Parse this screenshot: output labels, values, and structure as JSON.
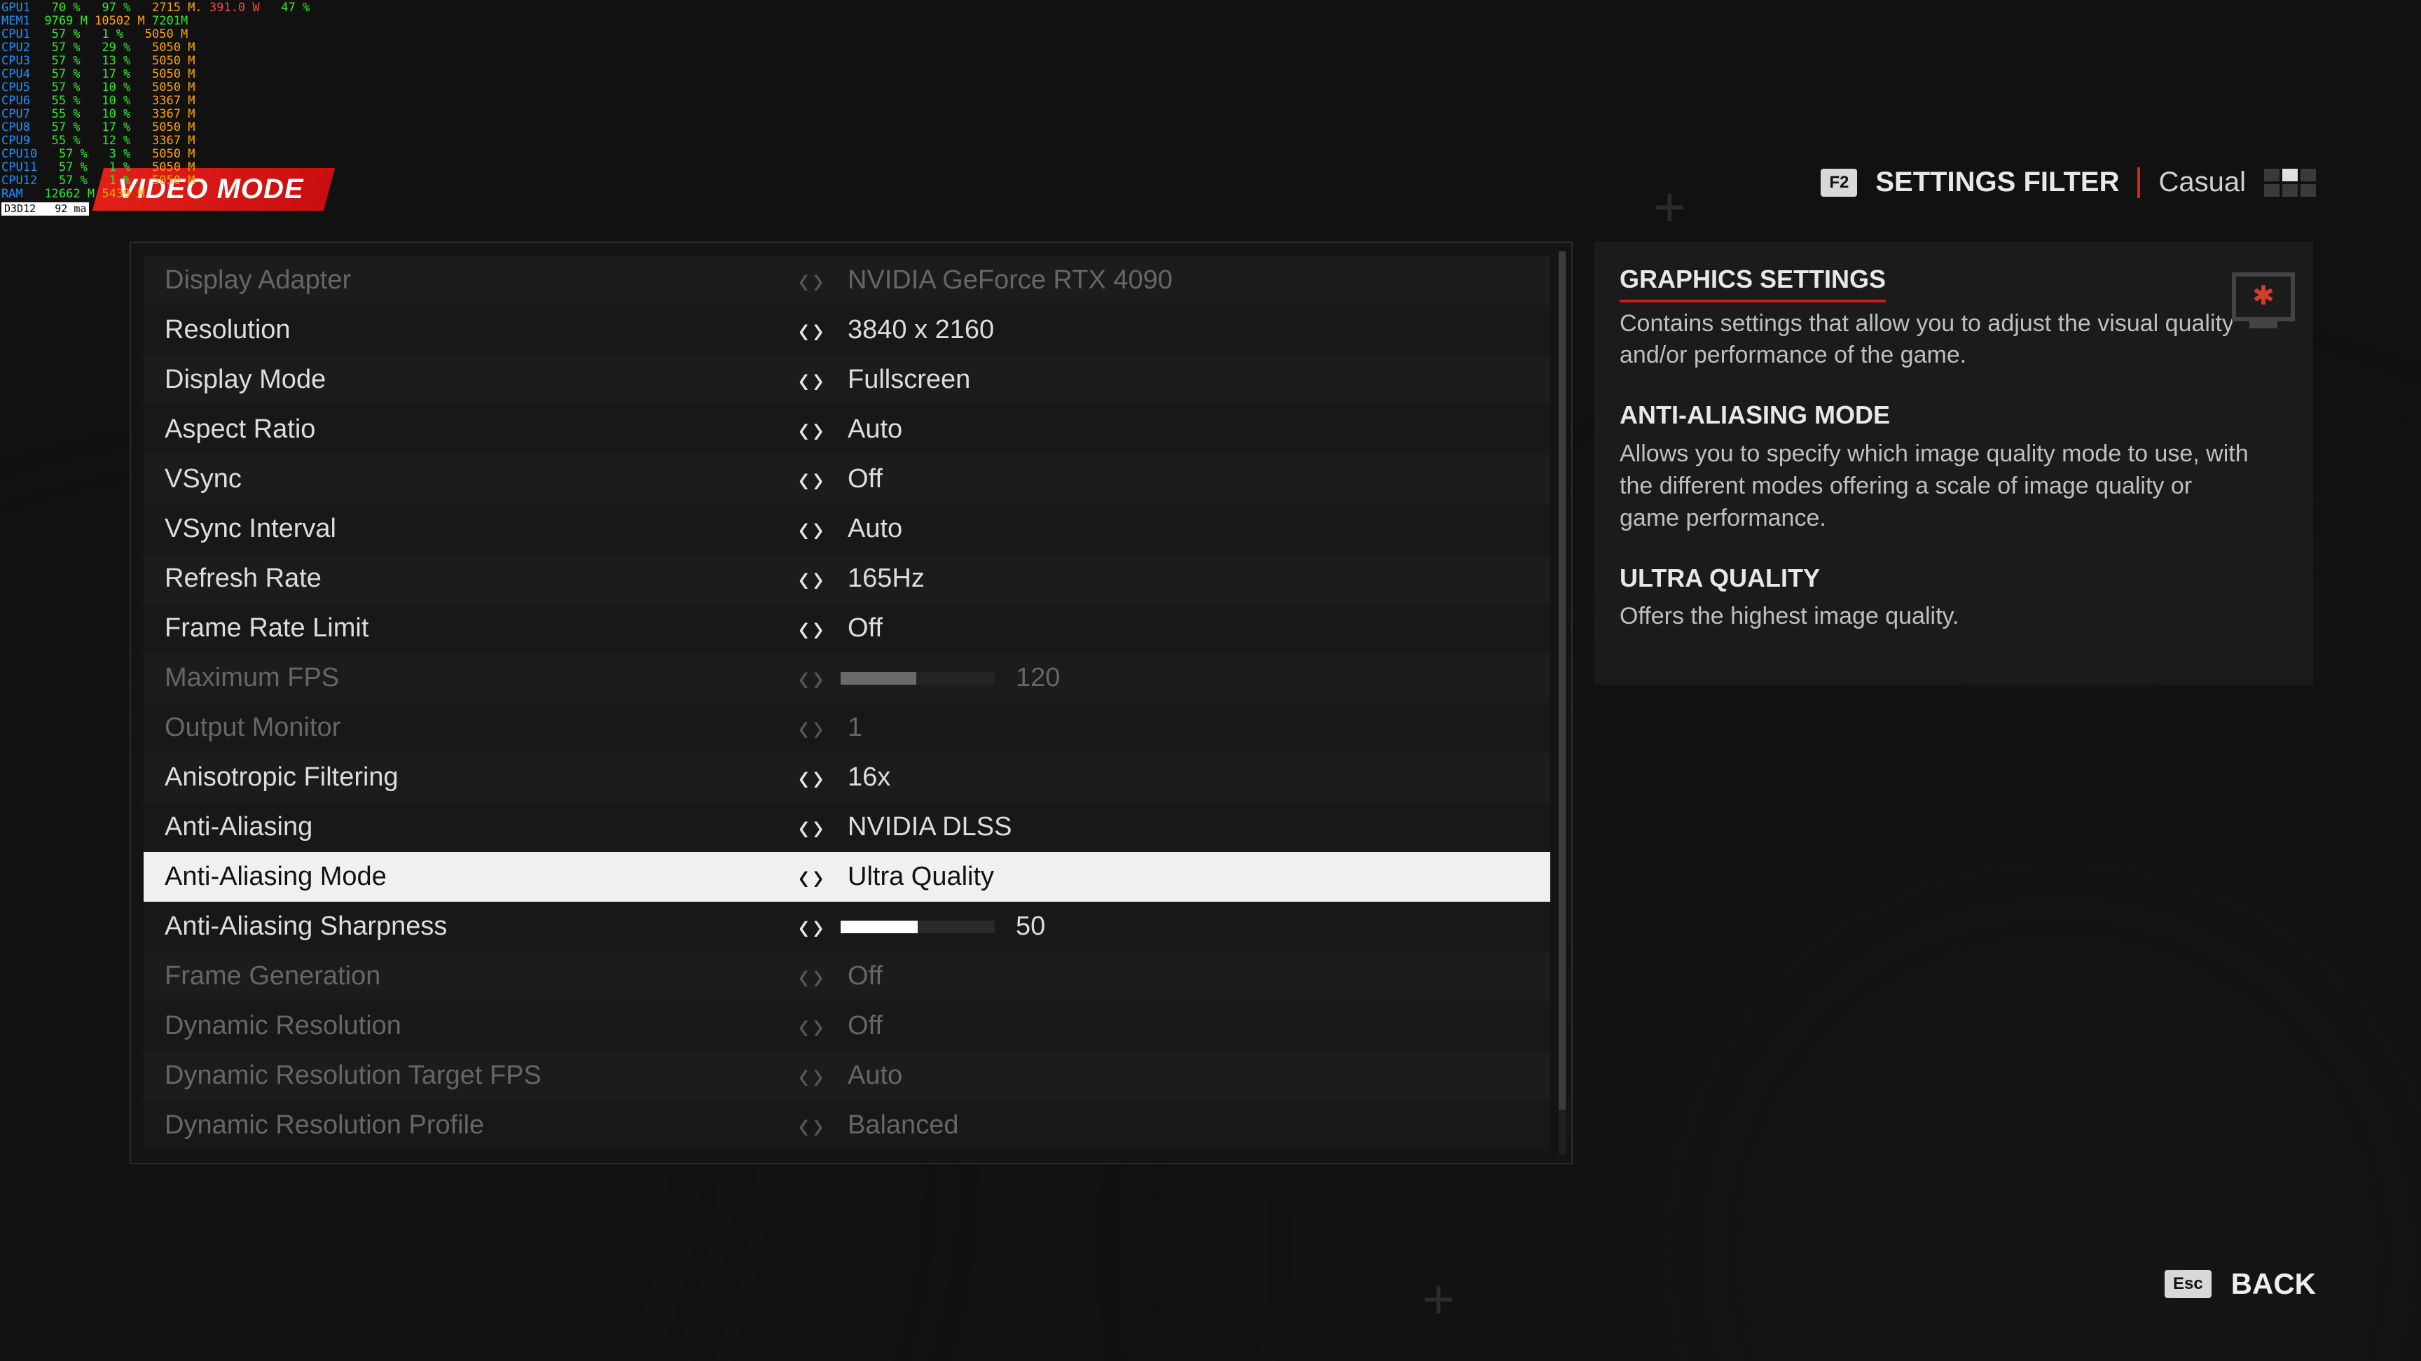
{
  "overlay": {
    "gpu": {
      "lbl": "GPU1",
      "a": "70 %",
      "b": "97 %",
      "c": "2715 M.",
      "d": "391.0 W",
      "e": "47 %"
    },
    "mem": {
      "lbl": "MEM1",
      "a": "9769 M",
      "b": "10502 M",
      "c": "7201M"
    },
    "cpus": [
      {
        "lbl": "CPU1",
        "a": "57 %",
        "b": "1 %",
        "c": "5050 M"
      },
      {
        "lbl": "CPU2",
        "a": "57 %",
        "b": "29 %",
        "c": "5050 M"
      },
      {
        "lbl": "CPU3",
        "a": "57 %",
        "b": "13 %",
        "c": "5050 M"
      },
      {
        "lbl": "CPU4",
        "a": "57 %",
        "b": "17 %",
        "c": "5050 M"
      },
      {
        "lbl": "CPU5",
        "a": "57 %",
        "b": "10 %",
        "c": "5050 M"
      },
      {
        "lbl": "CPU6",
        "a": "55 %",
        "b": "10 %",
        "c": "3367 M"
      },
      {
        "lbl": "CPU7",
        "a": "55 %",
        "b": "10 %",
        "c": "3367 M"
      },
      {
        "lbl": "CPU8",
        "a": "57 %",
        "b": "17 %",
        "c": "5050 M"
      },
      {
        "lbl": "CPU9",
        "a": "55 %",
        "b": "12 %",
        "c": "3367 M"
      },
      {
        "lbl": "CPU10",
        "a": "57 %",
        "b": "3 %",
        "c": "5050 M"
      },
      {
        "lbl": "CPU11",
        "a": "57 %",
        "b": "1 %",
        "c": "5050 M"
      },
      {
        "lbl": "CPU12",
        "a": "57 %",
        "b": "1 %",
        "c": "5050 M"
      }
    ],
    "ram": {
      "lbl": "RAM",
      "a": "12662 M",
      "b": "5439 M"
    },
    "d3d": {
      "lbl": "D3D12",
      "a": "92 ma"
    }
  },
  "header": {
    "title": "VIDEO MODE",
    "filter_key": "F2",
    "filter_label": "SETTINGS FILTER",
    "filter_value": "Casual"
  },
  "settings": [
    {
      "label": "Display Adapter",
      "value": "NVIDIA GeForce RTX 4090",
      "dim": true
    },
    {
      "label": "Resolution",
      "value": "3840 x 2160"
    },
    {
      "label": "Display Mode",
      "value": "Fullscreen"
    },
    {
      "label": "Aspect Ratio",
      "value": "Auto"
    },
    {
      "label": "VSync",
      "value": "Off"
    },
    {
      "label": "VSync Interval",
      "value": "Auto"
    },
    {
      "label": "Refresh Rate",
      "value": "165Hz"
    },
    {
      "label": "Frame Rate Limit",
      "value": "Off"
    },
    {
      "label": "Maximum FPS",
      "slider": 49,
      "sliderLabel": "120",
      "dim": true
    },
    {
      "label": "Output Monitor",
      "value": "1",
      "dim": true
    },
    {
      "label": "Anisotropic Filtering",
      "value": "16x"
    },
    {
      "label": "Anti-Aliasing",
      "value": "NVIDIA DLSS"
    },
    {
      "label": "Anti-Aliasing Mode",
      "value": "Ultra Quality",
      "selected": true
    },
    {
      "label": "Anti-Aliasing Sharpness",
      "slider": 50,
      "sliderLabel": "50"
    },
    {
      "label": "Frame Generation",
      "value": "Off",
      "dim": true
    },
    {
      "label": "Dynamic Resolution",
      "value": "Off",
      "dim": true
    },
    {
      "label": "Dynamic Resolution Target FPS",
      "value": "Auto",
      "dim": true
    },
    {
      "label": "Dynamic Resolution Profile",
      "value": "Balanced",
      "dim": true
    }
  ],
  "description": {
    "t1": "GRAPHICS SETTINGS",
    "p1": "Contains settings that allow you to adjust the visual quality and/or performance of the game.",
    "t2": "ANTI-ALIASING MODE",
    "p2": "Allows you to specify which image quality mode to use, with the different modes offering a scale of image quality or game performance.",
    "t3": "ULTRA QUALITY",
    "p3": "Offers the highest image quality."
  },
  "footer": {
    "back_key": "Esc",
    "back_label": "BACK"
  }
}
